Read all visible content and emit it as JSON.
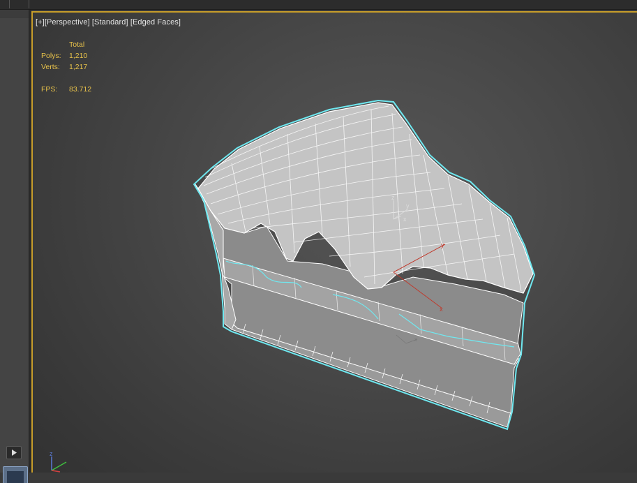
{
  "viewport": {
    "label": {
      "plus": "[+]",
      "view": "[Perspective]",
      "shading": "[Standard]",
      "display": "[Edged Faces]"
    },
    "stats": {
      "header": "Total",
      "polys_label": "Polys:",
      "polys_value": "1,210",
      "verts_label": "Verts:",
      "verts_value": "1,217",
      "fps_label": "FPS:",
      "fps_value": "83.712"
    },
    "gizmo_axes": {
      "x": "x",
      "y": "y",
      "z": "z"
    },
    "colors": {
      "border_active": "#c79d2a",
      "selection_outline": "#6fe8f0",
      "stats_text": "#e8c24a"
    }
  },
  "sidebar": {
    "play_icon": "play-icon"
  }
}
